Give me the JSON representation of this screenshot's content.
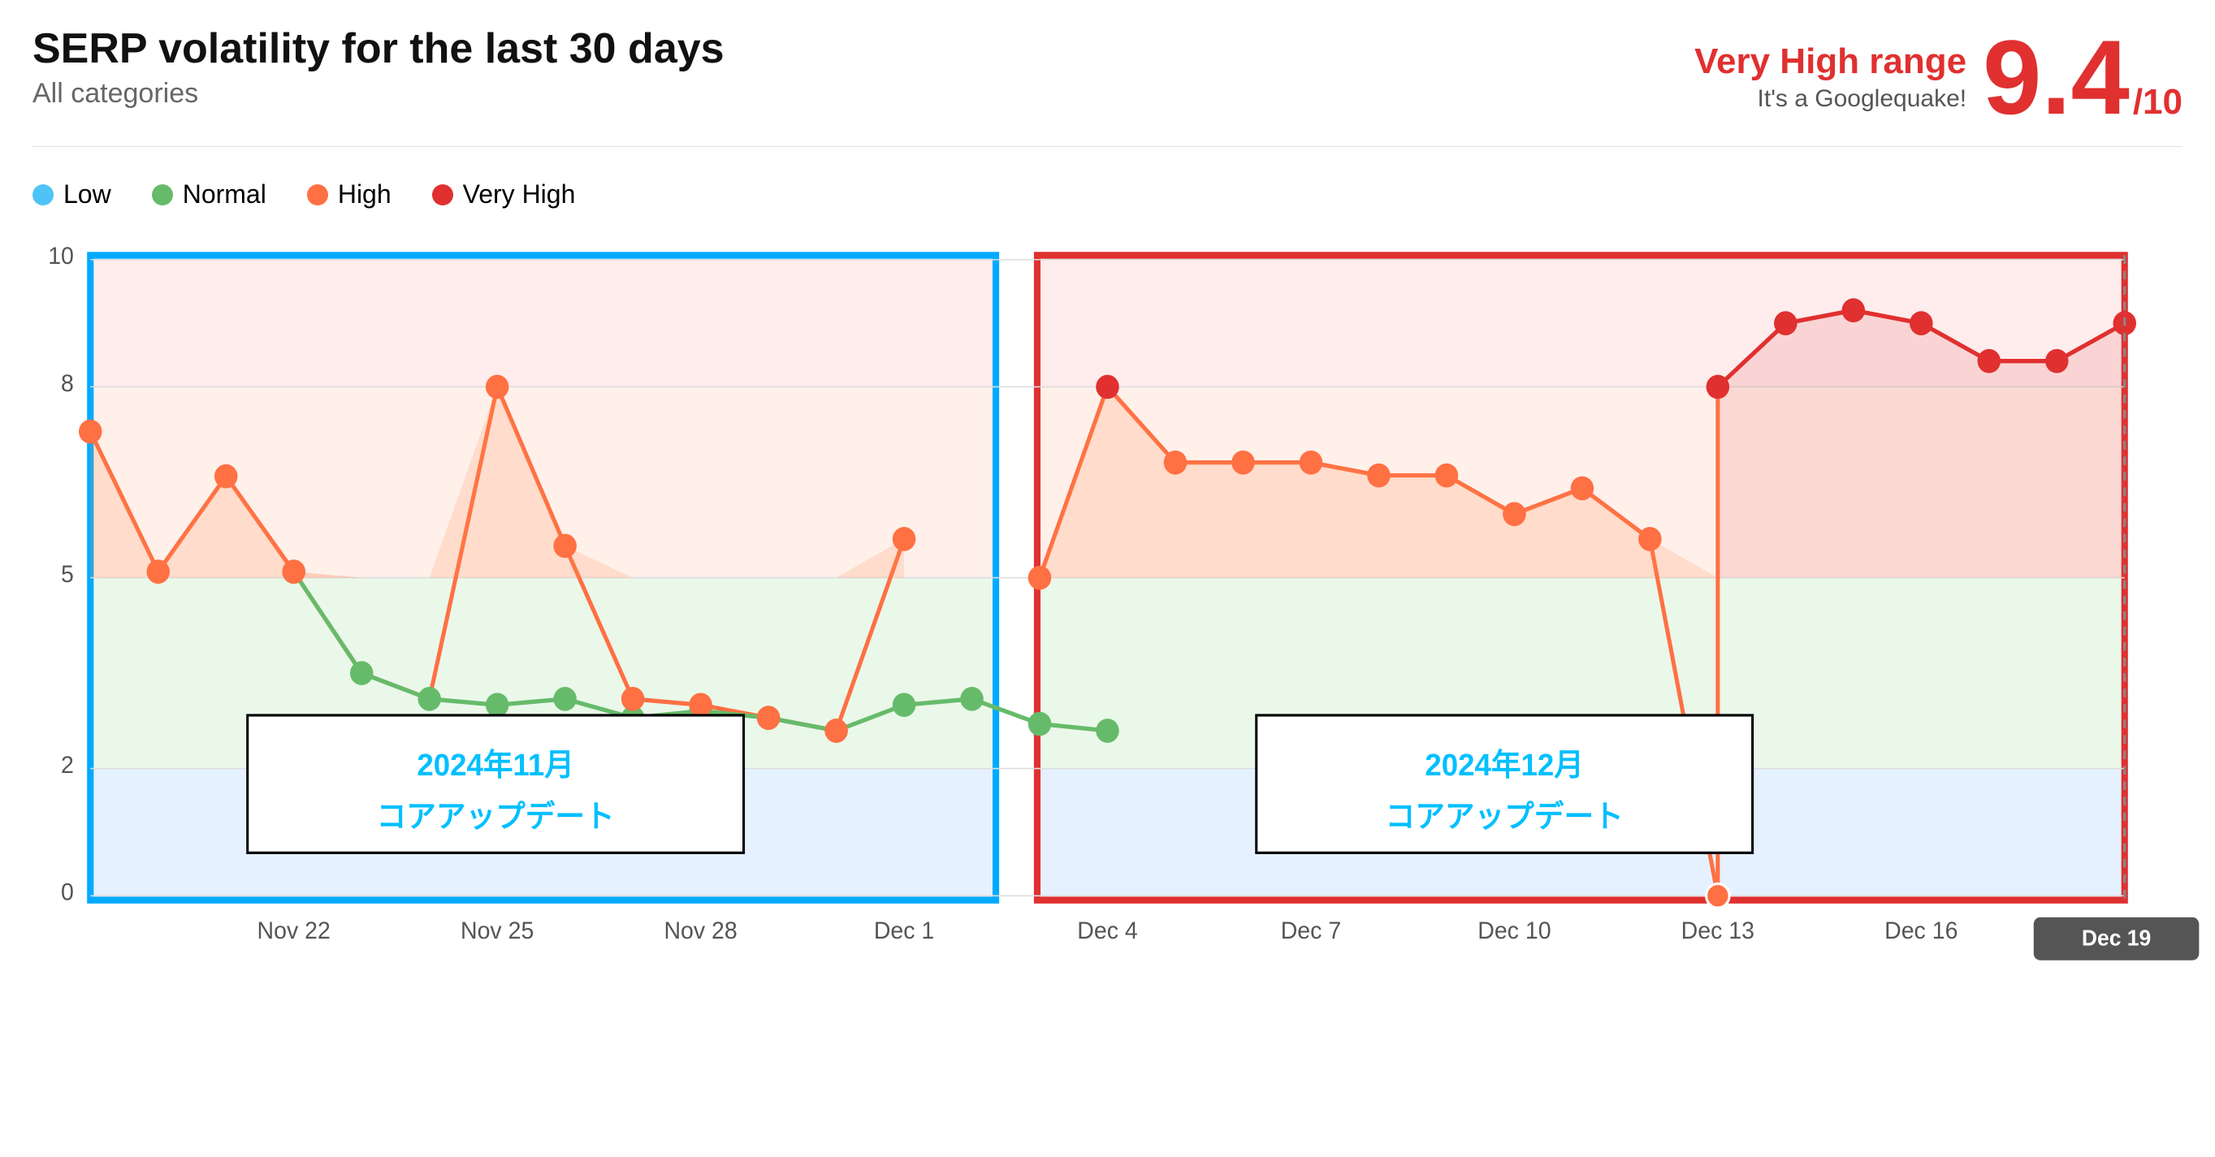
{
  "header": {
    "title": "SERP volatility for the last 30 days",
    "subtitle": "All categories",
    "range_label": "Very High range",
    "range_sublabel": "It's a Googlequake!",
    "score": "9.4",
    "score_denom": "/10"
  },
  "legend": [
    {
      "label": "Low",
      "color": "#4fc3f7"
    },
    {
      "label": "Normal",
      "color": "#66bb6a"
    },
    {
      "label": "High",
      "color": "#ff7043"
    },
    {
      "label": "Very High",
      "color": "#e03030"
    }
  ],
  "chart": {
    "y_labels": [
      "10",
      "8",
      "5",
      "2",
      "0"
    ],
    "x_labels": [
      "Nov 22",
      "Nov 25",
      "Nov 28",
      "Dec 1",
      "Dec 4",
      "Dec 7",
      "Dec 10",
      "Dec 13",
      "Dec 16",
      "Dec 19"
    ],
    "box_nov_label": "2024年11月\nコアアップデート",
    "box_dec_label": "2024年12月\nコアアップデート",
    "date_badge": "Dec 19"
  },
  "colors": {
    "blue_box": "#00aaff",
    "red_box": "#e03030",
    "score_color": "#e03030"
  }
}
